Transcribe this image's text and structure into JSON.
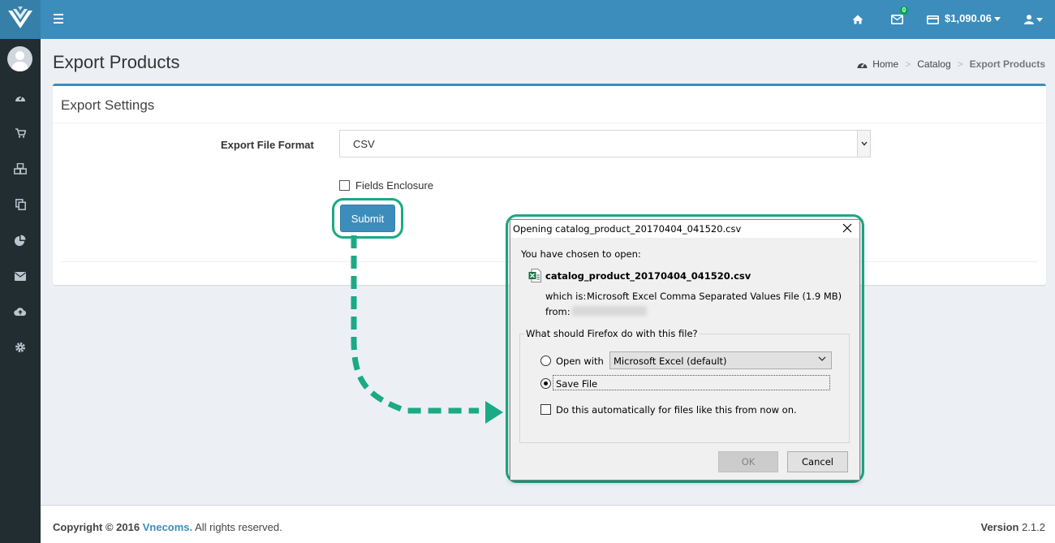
{
  "header": {
    "balance": "$1,090.06",
    "mail_badge": "0"
  },
  "sidebar": {
    "icons": [
      "dashboard-icon",
      "cart-icon",
      "cubes-icon",
      "copy-icon",
      "pie-chart-icon",
      "envelope-icon",
      "cloud-upload-icon",
      "gear-icon"
    ]
  },
  "page": {
    "title": "Export Products",
    "breadcrumb": [
      "Home",
      "Catalog",
      "Export Products"
    ]
  },
  "box": {
    "title": "Export Settings",
    "format_label": "Export File Format",
    "format_value": "CSV",
    "enclosure_label": "Fields Enclosure",
    "enclosure_checked": false,
    "submit_label": "Submit"
  },
  "footer": {
    "copyright_prefix": "Copyright © 2016",
    "company": "Vnecoms.",
    "rights": "All rights reserved.",
    "version_label": "Version",
    "version_number": "2.1.2"
  },
  "dialog": {
    "title": "Opening catalog_product_20170404_041520.csv",
    "chosen": "You have chosen to open:",
    "filename": "catalog_product_20170404_041520.csv",
    "which_is_label": "which is:",
    "which_is_value": "Microsoft Excel Comma Separated Values File (1.9 MB)",
    "from_label": "from:",
    "question": "What should Firefox do with this file?",
    "open_with_label": "Open with",
    "open_with_value": "Microsoft Excel (default)",
    "save_file_label": "Save File",
    "save_file_selected": true,
    "auto_label": "Do this automatically for files like this from now on.",
    "ok_label": "OK",
    "cancel_label": "Cancel"
  },
  "colors": {
    "header": "#3c8dbc",
    "sidebar": "#222d32",
    "highlight": "#1aaa85"
  }
}
